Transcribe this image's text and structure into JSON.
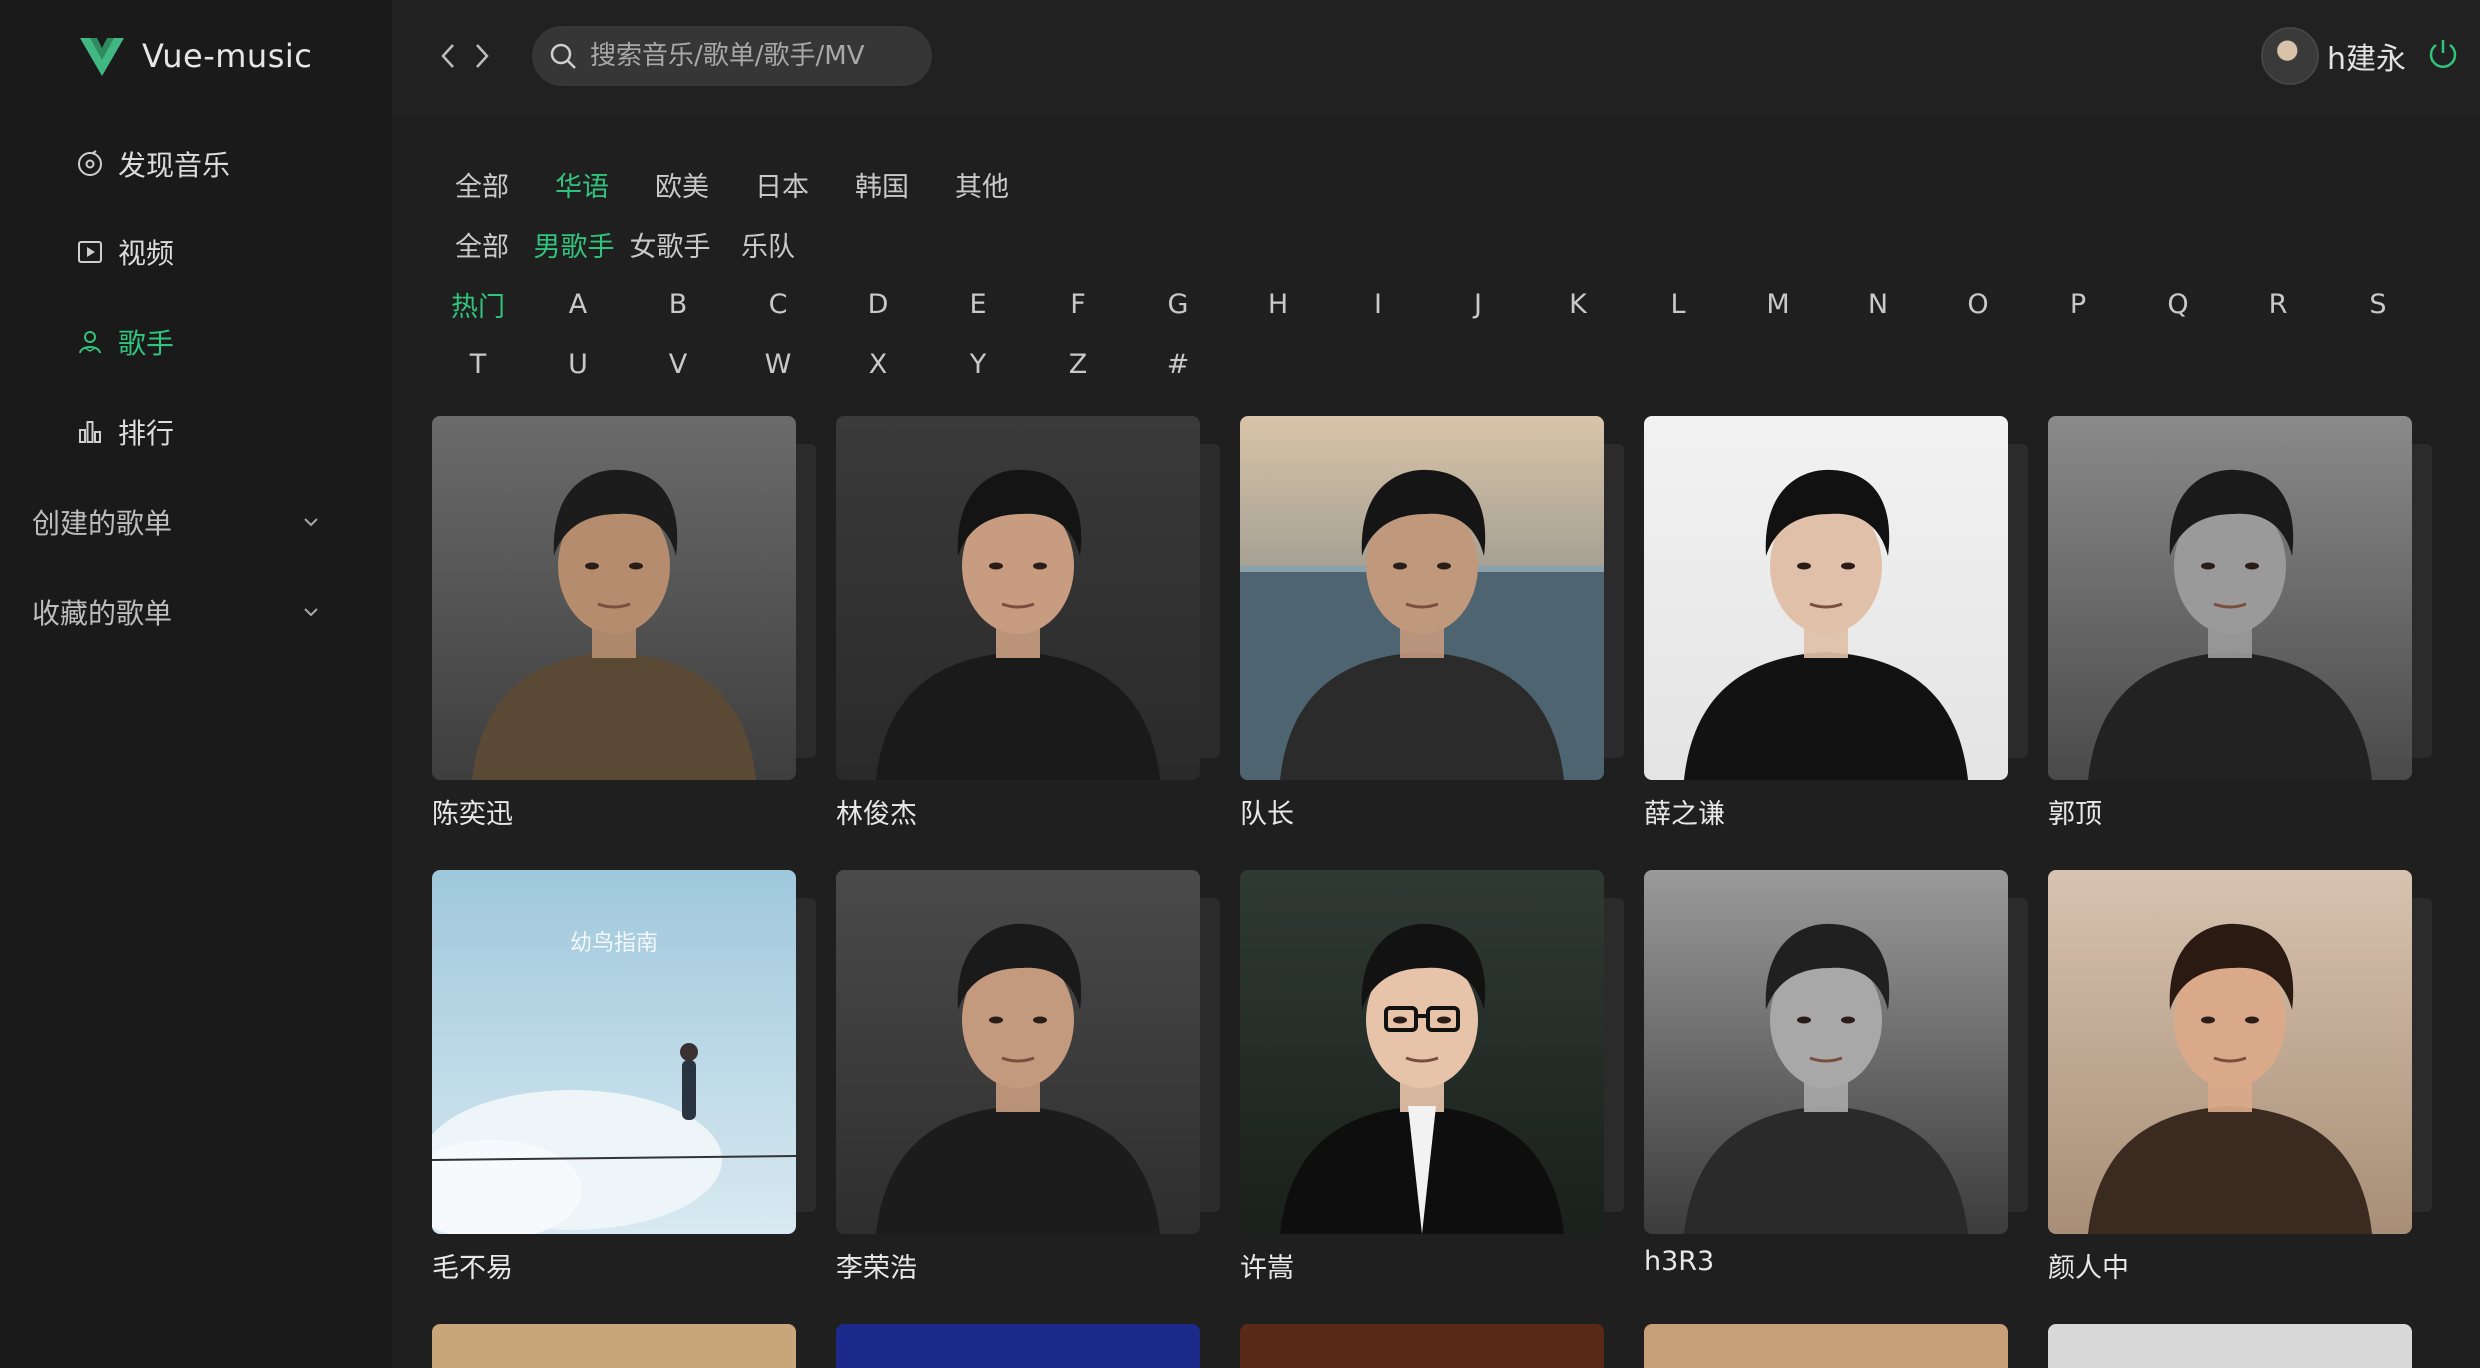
{
  "app": {
    "name": "Vue-music"
  },
  "sidebar": {
    "items": [
      {
        "label": "发现音乐",
        "icon": "music-disc-icon",
        "active": false
      },
      {
        "label": "视频",
        "icon": "video-play-icon",
        "active": false
      },
      {
        "label": "歌手",
        "icon": "singer-person-icon",
        "active": true
      },
      {
        "label": "排行",
        "icon": "chart-bars-icon",
        "active": false
      }
    ],
    "groups": [
      {
        "label": "创建的歌单",
        "icon": "chevron-down-icon"
      },
      {
        "label": "收藏的歌单",
        "icon": "chevron-down-icon"
      }
    ]
  },
  "header": {
    "search_placeholder": "搜索音乐/歌单/歌手/MV",
    "username": "h建永"
  },
  "filters": {
    "area": {
      "options": [
        "全部",
        "华语",
        "欧美",
        "日本",
        "韩国",
        "其他"
      ],
      "selected": "华语"
    },
    "type": {
      "options": [
        "全部",
        "男歌手",
        "女歌手",
        "乐队"
      ],
      "selected": "男歌手"
    },
    "initial": {
      "row1": [
        "热门",
        "A",
        "B",
        "C",
        "D",
        "E",
        "F",
        "G",
        "H",
        "I",
        "J",
        "K",
        "L",
        "M",
        "N",
        "O",
        "P",
        "Q",
        "R",
        "S"
      ],
      "row2": [
        "T",
        "U",
        "V",
        "W",
        "X",
        "Y",
        "Z",
        "#"
      ],
      "selected": "热门"
    }
  },
  "artists": [
    {
      "name": "陈奕迅"
    },
    {
      "name": "林俊杰"
    },
    {
      "name": "队长"
    },
    {
      "name": "薛之谦"
    },
    {
      "name": "郭顶"
    },
    {
      "name": "毛不易",
      "cover_text": "幼鸟指南"
    },
    {
      "name": "李荣浩"
    },
    {
      "name": "许嵩"
    },
    {
      "name": "h3R3"
    },
    {
      "name": "颜人中"
    }
  ],
  "colors": {
    "accent": "#31c27c",
    "background": "#1f1f1f",
    "sidebar": "#1a1a1a"
  }
}
